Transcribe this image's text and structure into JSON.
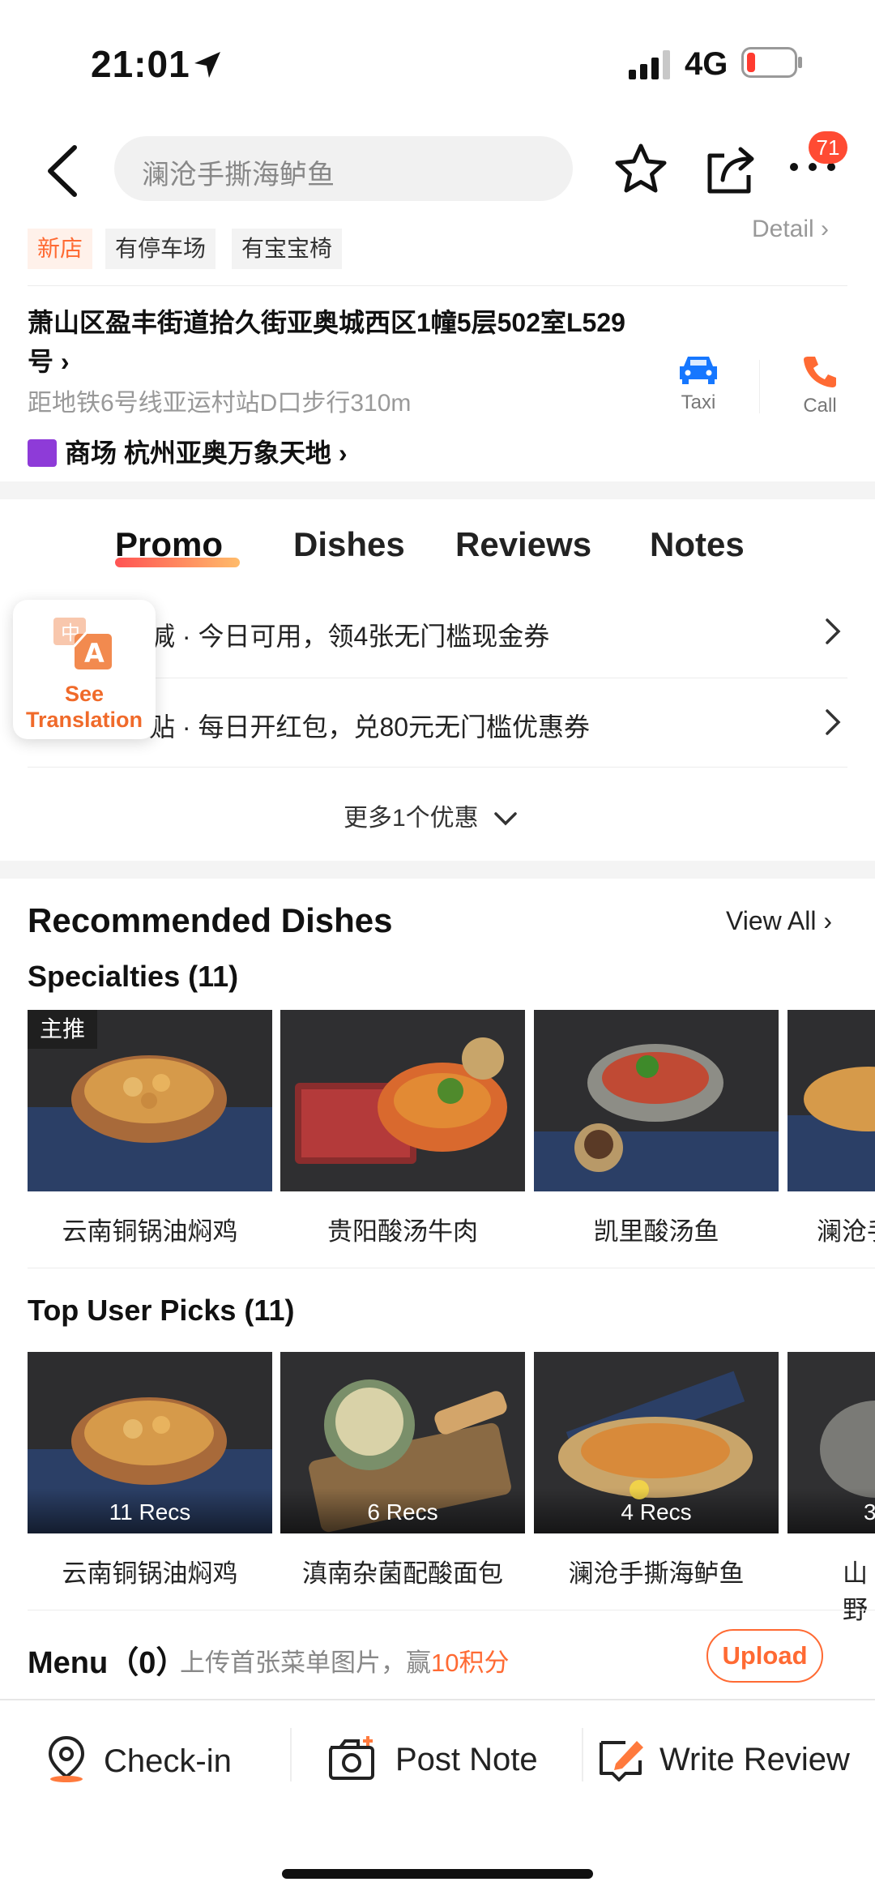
{
  "status_bar": {
    "time": "21:01",
    "network": "4G"
  },
  "header": {
    "search_text": "澜沧手撕海鲈鱼",
    "notification_count": "71"
  },
  "tags": [
    "新店",
    "有停车场",
    "有宝宝椅"
  ],
  "detail_link": "Detail",
  "address": {
    "line": "萧山区盈丰街道拾久街亚奥城西区1幢5层502室L529号",
    "subway": "距地铁6号线亚运村站D口步行310m",
    "mall_prefix": "商场",
    "mall_name": "杭州亚奥万象天地"
  },
  "actions": {
    "taxi": "Taxi",
    "call": "Call"
  },
  "tabs": [
    "Promo",
    "Dishes",
    "Reviews",
    "Notes"
  ],
  "promos": [
    {
      "text": "减 · 今日可用，领4张无门槛现金券"
    },
    {
      "text": "贴 · 每日开红包，兑80元无门槛优惠券"
    }
  ],
  "more_promos": "更多1个优惠",
  "translate_button": {
    "line1": "See",
    "line2": "Translation"
  },
  "recommended": {
    "title": "Recommended Dishes",
    "view_all": "View All",
    "specialties_title": "Specialties (11)",
    "specialties": [
      {
        "name": "云南铜锅油焖鸡",
        "badge": "主推"
      },
      {
        "name": "贵阳酸汤牛肉"
      },
      {
        "name": "凯里酸汤鱼"
      },
      {
        "name": "澜沧手"
      }
    ],
    "top_picks_title": "Top User Picks (11)",
    "top_picks": [
      {
        "name": "云南铜锅油焖鸡",
        "recs": "11 Recs"
      },
      {
        "name": "滇南杂菌配酸面包",
        "recs": "6 Recs"
      },
      {
        "name": "澜沧手撕海鲈鱼",
        "recs": "4 Recs"
      },
      {
        "name": "山野",
        "recs": "3"
      }
    ]
  },
  "menu": {
    "title": "Menu（0）",
    "sub_prefix": "上传首张菜单图片，赢",
    "points": "10积分",
    "upload": "Upload"
  },
  "bottom_bar": {
    "checkin": "Check-in",
    "post_note": "Post Note",
    "write_review": "Write Review"
  },
  "colors": {
    "accent": "#ff6a33",
    "badge": "#ff4b33",
    "taxi_blue": "#1677ff"
  }
}
